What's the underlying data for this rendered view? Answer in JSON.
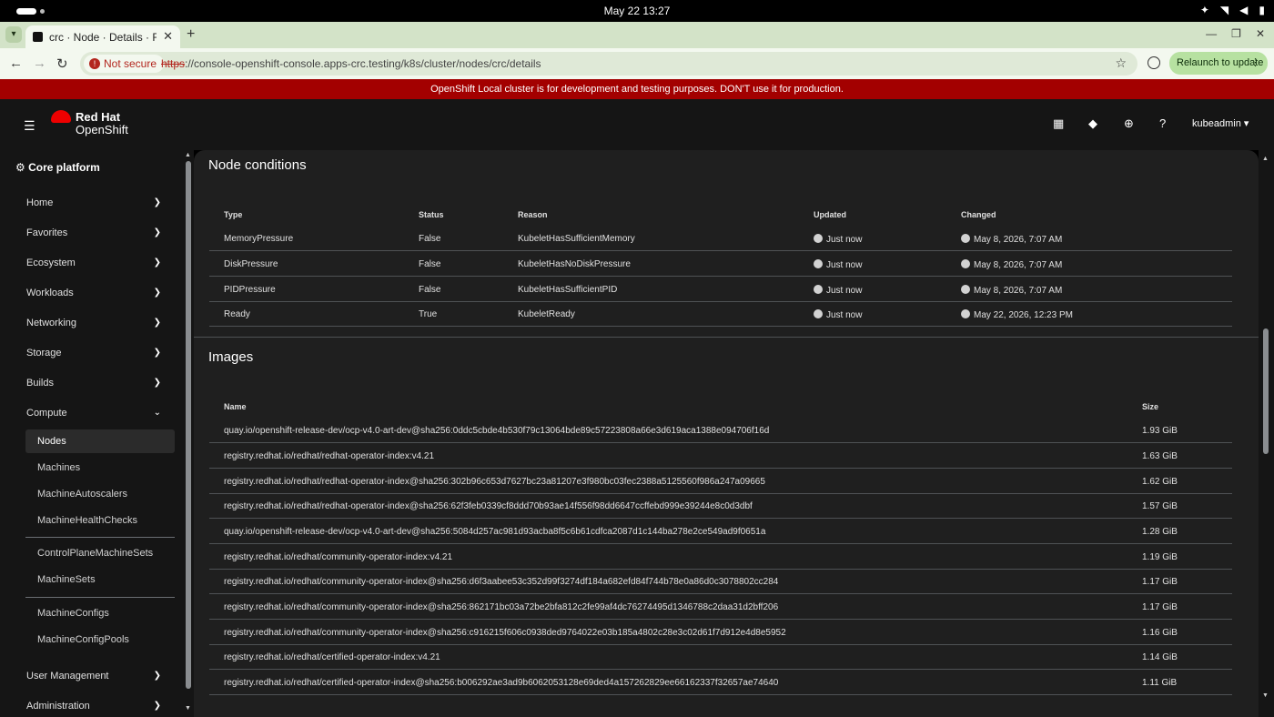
{
  "os": {
    "clock": "May 22  13:27"
  },
  "browser": {
    "tab_title": "crc · Node · Details · Red Hat OpenShift",
    "security_label": "Not secure",
    "url_scheme": "https",
    "url_rest": "://console-openshift-console.apps-crc.testing/k8s/cluster/nodes/crc/details",
    "relaunch_label": "Relaunch to update"
  },
  "banner": {
    "text": "OpenShift Local cluster is for development and testing purposes. DON'T use it for production."
  },
  "masthead": {
    "brand_line1": "Red Hat",
    "brand_line2": "OpenShift",
    "user": "kubeadmin"
  },
  "sidebar": {
    "perspective": "Core platform",
    "items": [
      {
        "label": "Home"
      },
      {
        "label": "Favorites"
      },
      {
        "label": "Ecosystem"
      },
      {
        "label": "Workloads"
      },
      {
        "label": "Networking"
      },
      {
        "label": "Storage"
      },
      {
        "label": "Builds"
      },
      {
        "label": "Compute"
      }
    ],
    "compute_items": [
      {
        "label": "Nodes",
        "active": true
      },
      {
        "label": "Machines"
      },
      {
        "label": "MachineAutoscalers"
      },
      {
        "label": "MachineHealthChecks"
      },
      {
        "label": "ControlPlaneMachineSets"
      },
      {
        "label": "MachineSets"
      },
      {
        "label": "MachineConfigs"
      },
      {
        "label": "MachineConfigPools"
      }
    ],
    "bottom_items": [
      {
        "label": "User Management"
      },
      {
        "label": "Administration"
      }
    ]
  },
  "conditions": {
    "title": "Node conditions",
    "columns": [
      "Type",
      "Status",
      "Reason",
      "Updated",
      "Changed"
    ],
    "rows": [
      {
        "type": "MemoryPressure",
        "status": "False",
        "reason": "KubeletHasSufficientMemory",
        "updated": "Just now",
        "changed": "May 8, 2026, 7:07 AM"
      },
      {
        "type": "DiskPressure",
        "status": "False",
        "reason": "KubeletHasNoDiskPressure",
        "updated": "Just now",
        "changed": "May 8, 2026, 7:07 AM"
      },
      {
        "type": "PIDPressure",
        "status": "False",
        "reason": "KubeletHasSufficientPID",
        "updated": "Just now",
        "changed": "May 8, 2026, 7:07 AM"
      },
      {
        "type": "Ready",
        "status": "True",
        "reason": "KubeletReady",
        "updated": "Just now",
        "changed": "May 22, 2026, 12:23 PM"
      }
    ]
  },
  "images": {
    "title": "Images",
    "columns": [
      "Name",
      "Size"
    ],
    "rows": [
      {
        "name": "quay.io/openshift-release-dev/ocp-v4.0-art-dev@sha256:0ddc5cbde4b530f79c13064bde89c57223808a66e3d619aca1388e094706f16d",
        "size": "1.93 GiB"
      },
      {
        "name": "registry.redhat.io/redhat/redhat-operator-index:v4.21",
        "size": "1.63 GiB"
      },
      {
        "name": "registry.redhat.io/redhat/redhat-operator-index@sha256:302b96c653d7627bc23a81207e3f980bc03fec2388a5125560f986a247a09665",
        "size": "1.62 GiB"
      },
      {
        "name": "registry.redhat.io/redhat/redhat-operator-index@sha256:62f3feb0339cf8ddd70b93ae14f556f98dd6647ccffebd999e39244e8c0d3dbf",
        "size": "1.57 GiB"
      },
      {
        "name": "quay.io/openshift-release-dev/ocp-v4.0-art-dev@sha256:5084d257ac981d93acba8f5c6b61cdfca2087d1c144ba278e2ce549ad9f0651a",
        "size": "1.28 GiB"
      },
      {
        "name": "registry.redhat.io/redhat/community-operator-index:v4.21",
        "size": "1.19 GiB"
      },
      {
        "name": "registry.redhat.io/redhat/community-operator-index@sha256:d6f3aabee53c352d99f3274df184a682efd84f744b78e0a86d0c3078802cc284",
        "size": "1.17 GiB"
      },
      {
        "name": "registry.redhat.io/redhat/community-operator-index@sha256:862171bc03a72be2bfa812c2fe99af4dc76274495d1346788c2daa31d2bff206",
        "size": "1.17 GiB"
      },
      {
        "name": "registry.redhat.io/redhat/community-operator-index@sha256:c916215f606c0938ded9764022e03b185a4802c28e3c02d61f7d912e4d8e5952",
        "size": "1.16 GiB"
      },
      {
        "name": "registry.redhat.io/redhat/certified-operator-index:v4.21",
        "size": "1.14 GiB"
      },
      {
        "name": "registry.redhat.io/redhat/certified-operator-index@sha256:b006292ae3ad9b6062053128e69ded4a157262829ee66162337f32657ae74640",
        "size": "1.11 GiB"
      }
    ]
  }
}
